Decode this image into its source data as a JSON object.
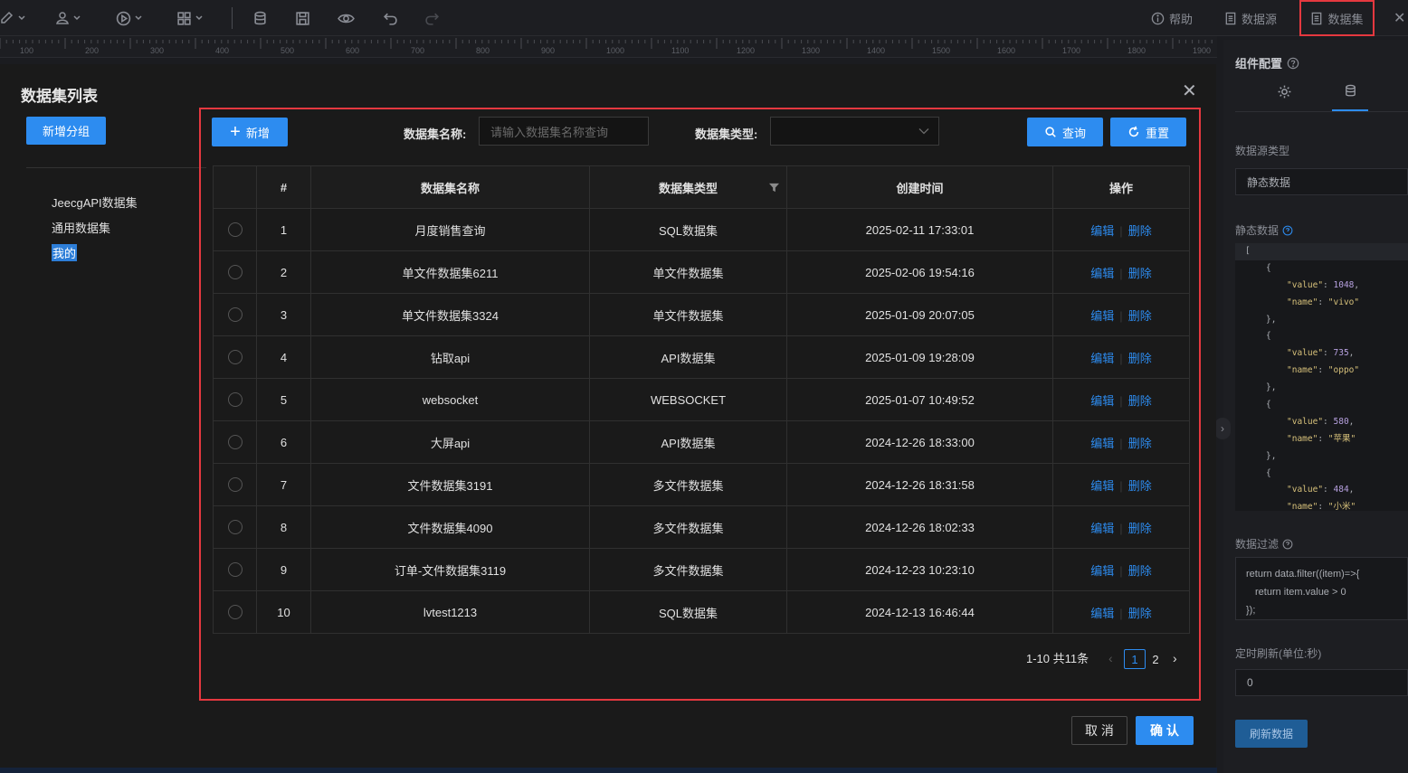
{
  "toolbar": {
    "help": "帮助",
    "datasource": "数据源",
    "dataset": "数据集"
  },
  "ruler": [
    "100",
    "200",
    "300",
    "400",
    "500",
    "600",
    "700",
    "800",
    "900",
    "1000",
    "1100",
    "1200",
    "1300",
    "1400",
    "1500",
    "1600",
    "1700",
    "1800",
    "1900"
  ],
  "right_panel": {
    "title": "组件配置",
    "datasource_type_label": "数据源类型",
    "datasource_type_value": "静态数据",
    "static_data_label": "静态数据",
    "code": {
      "bracket": "[",
      "open": "{",
      "close": "},",
      "value_key": "\"value\"",
      "name_key": "\"name\"",
      "v1": "1048",
      "n1": "\"vivo\"",
      "v2": "735",
      "n2": "\"oppo\"",
      "v3": "580",
      "n3": "\"苹果\"",
      "v4": "484",
      "n4": "\"小米\""
    },
    "filter_label": "数据过滤",
    "filter_line1": "return data.filter((item)=>{",
    "filter_line2": "return item.value > 0",
    "filter_line3": "});",
    "refresh_label": "定时刷新(单位:秒)",
    "refresh_value": "0",
    "refresh_button": "刷新数据"
  },
  "modal": {
    "title": "数据集列表",
    "add_group": "新增分组",
    "tree": [
      "JeecgAPI数据集",
      "通用数据集",
      "我的"
    ],
    "new_button": "新增",
    "name_label": "数据集名称:",
    "name_placeholder": "请输入数据集名称查询",
    "type_label": "数据集类型:",
    "type_value": "",
    "query_button": "查询",
    "reset_button": "重置",
    "columns": [
      "#",
      "数据集名称",
      "数据集类型",
      "创建时间",
      "操作"
    ],
    "edit": "编辑",
    "delete": "删除",
    "rows": [
      {
        "no": "1",
        "name": "月度销售查询",
        "type": "SQL数据集",
        "time": "2025-02-11 17:33:01"
      },
      {
        "no": "2",
        "name": "单文件数据集6211",
        "type": "单文件数据集",
        "time": "2025-02-06 19:54:16"
      },
      {
        "no": "3",
        "name": "单文件数据集3324",
        "type": "单文件数据集",
        "time": "2025-01-09 20:07:05"
      },
      {
        "no": "4",
        "name": "钻取api",
        "type": "API数据集",
        "time": "2025-01-09 19:28:09"
      },
      {
        "no": "5",
        "name": "websocket",
        "type": "WEBSOCKET",
        "time": "2025-01-07 10:49:52"
      },
      {
        "no": "6",
        "name": "大屏api",
        "type": "API数据集",
        "time": "2024-12-26 18:33:00"
      },
      {
        "no": "7",
        "name": "文件数据集3191",
        "type": "多文件数据集",
        "time": "2024-12-26 18:31:58"
      },
      {
        "no": "8",
        "name": "文件数据集4090",
        "type": "多文件数据集",
        "time": "2024-12-26 18:02:33"
      },
      {
        "no": "9",
        "name": "订单-文件数据集3119",
        "type": "多文件数据集",
        "time": "2024-12-23 10:23:10"
      },
      {
        "no": "10",
        "name": "lvtest1213",
        "type": "SQL数据集",
        "time": "2024-12-13 16:46:44"
      }
    ],
    "pagination": {
      "summary": "1-10 共11条",
      "pages": [
        "1",
        "2"
      ],
      "current": "1"
    },
    "cancel": "取 消",
    "confirm": "确 认"
  }
}
